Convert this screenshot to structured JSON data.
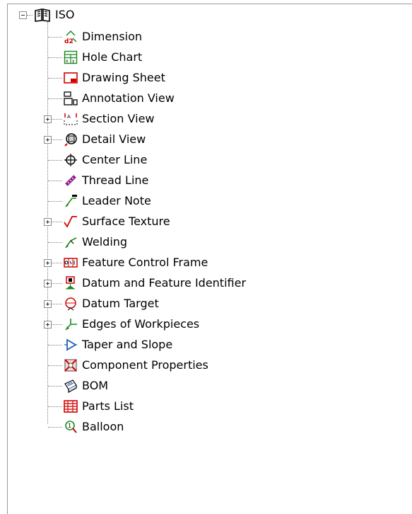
{
  "tree": {
    "root": {
      "label": "ISO",
      "expanded": true,
      "icon": "book-icon"
    },
    "items": [
      {
        "label": "Dimension",
        "icon": "dimension-icon",
        "expandable": false
      },
      {
        "label": "Hole Chart",
        "icon": "hole-chart-icon",
        "expandable": false
      },
      {
        "label": "Drawing Sheet",
        "icon": "drawing-sheet-icon",
        "expandable": false
      },
      {
        "label": "Annotation View",
        "icon": "annotation-view-icon",
        "expandable": false
      },
      {
        "label": "Section View",
        "icon": "section-view-icon",
        "expandable": true
      },
      {
        "label": "Detail View",
        "icon": "detail-view-icon",
        "expandable": true
      },
      {
        "label": "Center Line",
        "icon": "center-line-icon",
        "expandable": false
      },
      {
        "label": "Thread Line",
        "icon": "thread-line-icon",
        "expandable": false
      },
      {
        "label": "Leader Note",
        "icon": "leader-note-icon",
        "expandable": false
      },
      {
        "label": "Surface Texture",
        "icon": "surface-texture-icon",
        "expandable": true
      },
      {
        "label": "Welding",
        "icon": "welding-icon",
        "expandable": false
      },
      {
        "label": "Feature Control Frame",
        "icon": "feature-control-frame-icon",
        "expandable": true
      },
      {
        "label": "Datum and Feature Identifier",
        "icon": "datum-feature-identifier-icon",
        "expandable": true
      },
      {
        "label": "Datum Target",
        "icon": "datum-target-icon",
        "expandable": true
      },
      {
        "label": "Edges of Workpieces",
        "icon": "edges-of-workpieces-icon",
        "expandable": true
      },
      {
        "label": "Taper and Slope",
        "icon": "taper-slope-icon",
        "expandable": false
      },
      {
        "label": "Component Properties",
        "icon": "component-properties-icon",
        "expandable": false
      },
      {
        "label": "BOM",
        "icon": "bom-icon",
        "expandable": false
      },
      {
        "label": "Parts List",
        "icon": "parts-list-icon",
        "expandable": false
      },
      {
        "label": "Balloon",
        "icon": "balloon-icon",
        "expandable": false
      }
    ]
  },
  "colors": {
    "accent_red": "#d40000",
    "accent_green": "#1a8a1a",
    "line_gray": "#7f7f7f"
  }
}
